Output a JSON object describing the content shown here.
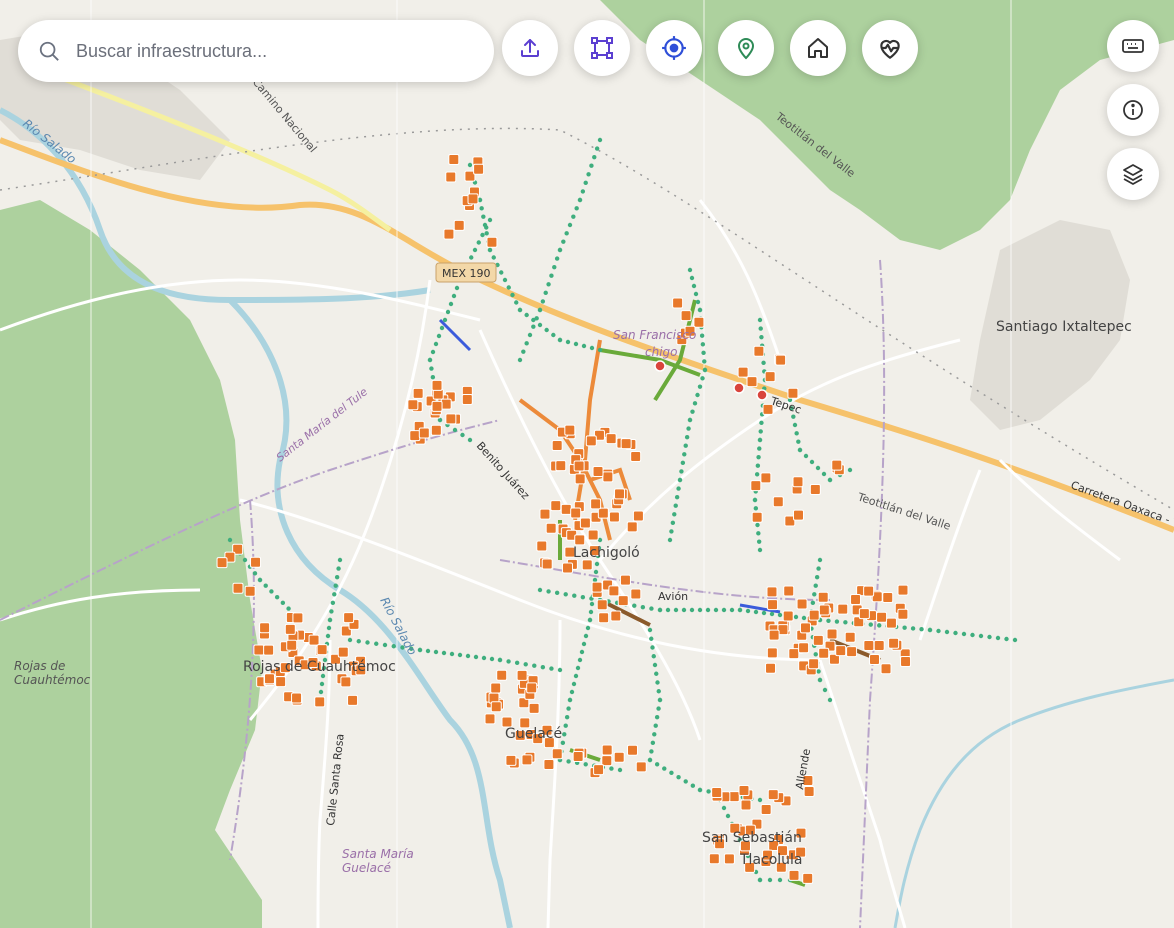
{
  "search": {
    "placeholder": "Buscar infraestructura..."
  },
  "toolbar": {
    "buttons": [
      {
        "icon": "upload-icon",
        "color": "#5b3fd1"
      },
      {
        "icon": "polygon-select-icon",
        "color": "#5b3fd1"
      },
      {
        "icon": "crosshair-icon",
        "color": "#2f4fd8"
      },
      {
        "icon": "map-pin-icon",
        "color": "#2e8b57"
      },
      {
        "icon": "home-icon",
        "color": "#333333"
      },
      {
        "icon": "heart-pulse-icon",
        "color": "#333333"
      }
    ]
  },
  "side_controls": [
    {
      "icon": "keyboard-icon"
    },
    {
      "icon": "info-icon"
    },
    {
      "icon": "layers-icon"
    }
  ],
  "map": {
    "colors": {
      "land": "#f1efe9",
      "forest": "#add19e",
      "river": "#aad3df",
      "highway": "#f6c26b",
      "node": "#3fae7e",
      "building_marker": "#e8792b",
      "pipe_orange": "#ec8a3a",
      "pipe_green": "#6aaa3a",
      "pipe_brown": "#8b5a2b",
      "pipe_blue": "#3b5bdb",
      "alert": "#d9443c"
    },
    "labels": {
      "rio_salado_1": "Río Salado",
      "camino_nacional": "Camino Nacional",
      "teotitlan_1": "Teotitlán del Valle",
      "mex_shield": "MEX 190",
      "santiago": "Santiago Ixtaltepec",
      "san_francisco": "San Francisco",
      "lachigolo_frag": "chigo",
      "santa_maria_tule": "Santa María del Tule",
      "benito_juarez": "Benito Juárez",
      "tepec_frag": "Tepec",
      "teotitlan_2": "Teotitlán del Valle",
      "carretera": "Carretera Oaxaca - Tehuantepec",
      "lachigolo": "Lachigoló",
      "avion_frag": "Avión",
      "rio_salado_2": "Río Salado",
      "rojas_cuauhtemoc_area": "Rojas de\nCuauhtémoc",
      "rojas_cuauhtemoc_town": "Rojas de Cuauhtémoc",
      "guelace_frag": "Guelacé",
      "calle_santa_rosa": "Calle Santa Rosa",
      "allende": "Allende",
      "santa_maria_guelace": "Santa María\nGuelacé",
      "san_sebastian": "San Sebastián",
      "tlacolula_frag": "Tlacolula"
    }
  }
}
